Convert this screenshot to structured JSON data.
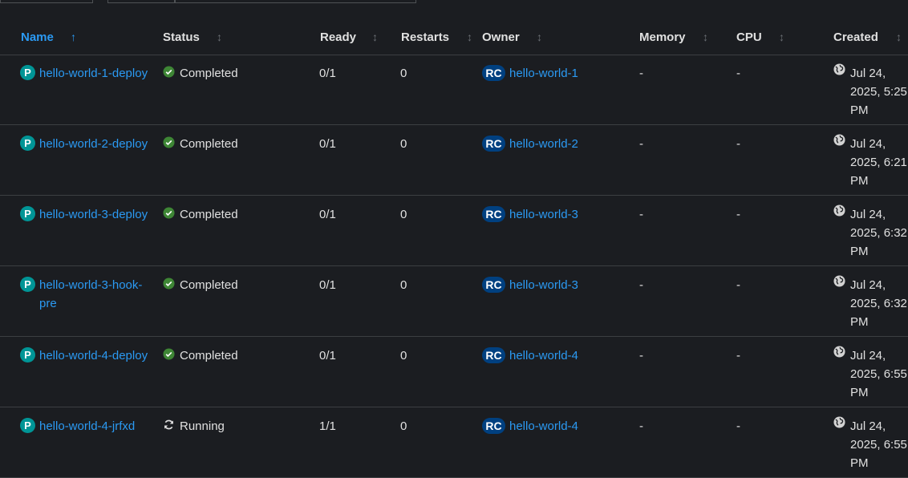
{
  "table": {
    "columns": {
      "name": "Name",
      "status": "Status",
      "ready": "Ready",
      "restarts": "Restarts",
      "owner": "Owner",
      "memory": "Memory",
      "cpu": "CPU",
      "created": "Created"
    },
    "sort_icon_asc": "↑",
    "sort_icon_neutral": "↕",
    "rows": [
      {
        "badge": "P",
        "name": "hello-world-1-deploy",
        "status": "Completed",
        "status_icon": "check-circle-icon",
        "ready": "0/1",
        "restarts": "0",
        "owner_badge": "RC",
        "owner": "hello-world-1",
        "memory": "-",
        "cpu": "-",
        "created": "Jul 24, 2025, 5:25 PM"
      },
      {
        "badge": "P",
        "name": "hello-world-2-deploy",
        "status": "Completed",
        "status_icon": "check-circle-icon",
        "ready": "0/1",
        "restarts": "0",
        "owner_badge": "RC",
        "owner": "hello-world-2",
        "memory": "-",
        "cpu": "-",
        "created": "Jul 24, 2025, 6:21 PM"
      },
      {
        "badge": "P",
        "name": "hello-world-3-deploy",
        "status": "Completed",
        "status_icon": "check-circle-icon",
        "ready": "0/1",
        "restarts": "0",
        "owner_badge": "RC",
        "owner": "hello-world-3",
        "memory": "-",
        "cpu": "-",
        "created": "Jul 24, 2025, 6:32 PM"
      },
      {
        "badge": "P",
        "name": "hello-world-3-hook-pre",
        "status": "Completed",
        "status_icon": "check-circle-icon",
        "ready": "0/1",
        "restarts": "0",
        "owner_badge": "RC",
        "owner": "hello-world-3",
        "memory": "-",
        "cpu": "-",
        "created": "Jul 24, 2025, 6:32 PM"
      },
      {
        "badge": "P",
        "name": "hello-world-4-deploy",
        "status": "Completed",
        "status_icon": "check-circle-icon",
        "ready": "0/1",
        "restarts": "0",
        "owner_badge": "RC",
        "owner": "hello-world-4",
        "memory": "-",
        "cpu": "-",
        "created": "Jul 24, 2025, 6:55 PM"
      },
      {
        "badge": "P",
        "name": "hello-world-4-jrfxd",
        "status": "Running",
        "status_icon": "sync-icon",
        "ready": "1/1",
        "restarts": "0",
        "owner_badge": "RC",
        "owner": "hello-world-4",
        "memory": "-",
        "cpu": "-",
        "created": "Jul 24, 2025, 6:55 PM"
      }
    ]
  },
  "colors": {
    "background": "#1b1d21",
    "link": "#2b9af3",
    "pod_badge": "#009596",
    "rc_badge": "#004080",
    "success": "#3e8635"
  }
}
